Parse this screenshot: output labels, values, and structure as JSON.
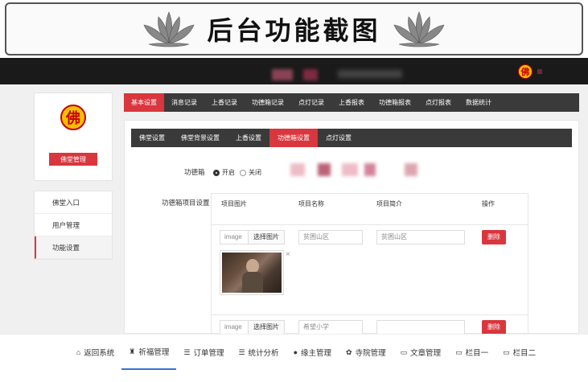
{
  "banner": {
    "title": "后台功能截图"
  },
  "header": {
    "logo_char": "佛"
  },
  "sidebar": {
    "logo_char": "佛",
    "temple_name": "",
    "manage_button": "佛堂管理",
    "items": [
      {
        "label": "佛堂入口"
      },
      {
        "label": "用户管理"
      },
      {
        "label": "功能设置"
      }
    ]
  },
  "main_nav": {
    "tabs": [
      {
        "label": "基本设置"
      },
      {
        "label": "消息记录"
      },
      {
        "label": "上香记录"
      },
      {
        "label": "功德箱记录"
      },
      {
        "label": "点灯记录"
      },
      {
        "label": "上香报表"
      },
      {
        "label": "功德箱报表"
      },
      {
        "label": "点灯报表"
      },
      {
        "label": "数据统计"
      }
    ]
  },
  "sub_nav": {
    "tabs": [
      {
        "label": "佛堂设置"
      },
      {
        "label": "佛堂背景设置"
      },
      {
        "label": "上香设置"
      },
      {
        "label": "功德箱设置"
      },
      {
        "label": "点灯设置"
      }
    ]
  },
  "form": {
    "donation_box_label": "功德箱",
    "radio_on": "开启",
    "radio_off": "关闭",
    "items_label": "功德箱项目设置",
    "table": {
      "headers": [
        "项目图片",
        "项目名称",
        "项目简介",
        "操作"
      ],
      "rows": [
        {
          "image_input": "image",
          "select_button": "选择图片",
          "name": "贫困山区",
          "intro": "贫困山区",
          "delete": "删除"
        },
        {
          "image_input": "image",
          "select_button": "选择图片",
          "name": "希望小学",
          "intro": "",
          "delete": "删除"
        }
      ]
    }
  },
  "bottom_nav": {
    "items": [
      {
        "icon": "home-icon",
        "label": "返回系统"
      },
      {
        "icon": "gift-icon",
        "label": "祈福管理"
      },
      {
        "icon": "list-icon",
        "label": "订单管理"
      },
      {
        "icon": "list-icon",
        "label": "统计分析"
      },
      {
        "icon": "user-icon",
        "label": "缘主管理"
      },
      {
        "icon": "cogs-icon",
        "label": "寺院管理"
      },
      {
        "icon": "card-icon",
        "label": "文章管理"
      },
      {
        "icon": "card-icon",
        "label": "栏目一"
      },
      {
        "icon": "card-icon",
        "label": "栏目二"
      }
    ]
  }
}
